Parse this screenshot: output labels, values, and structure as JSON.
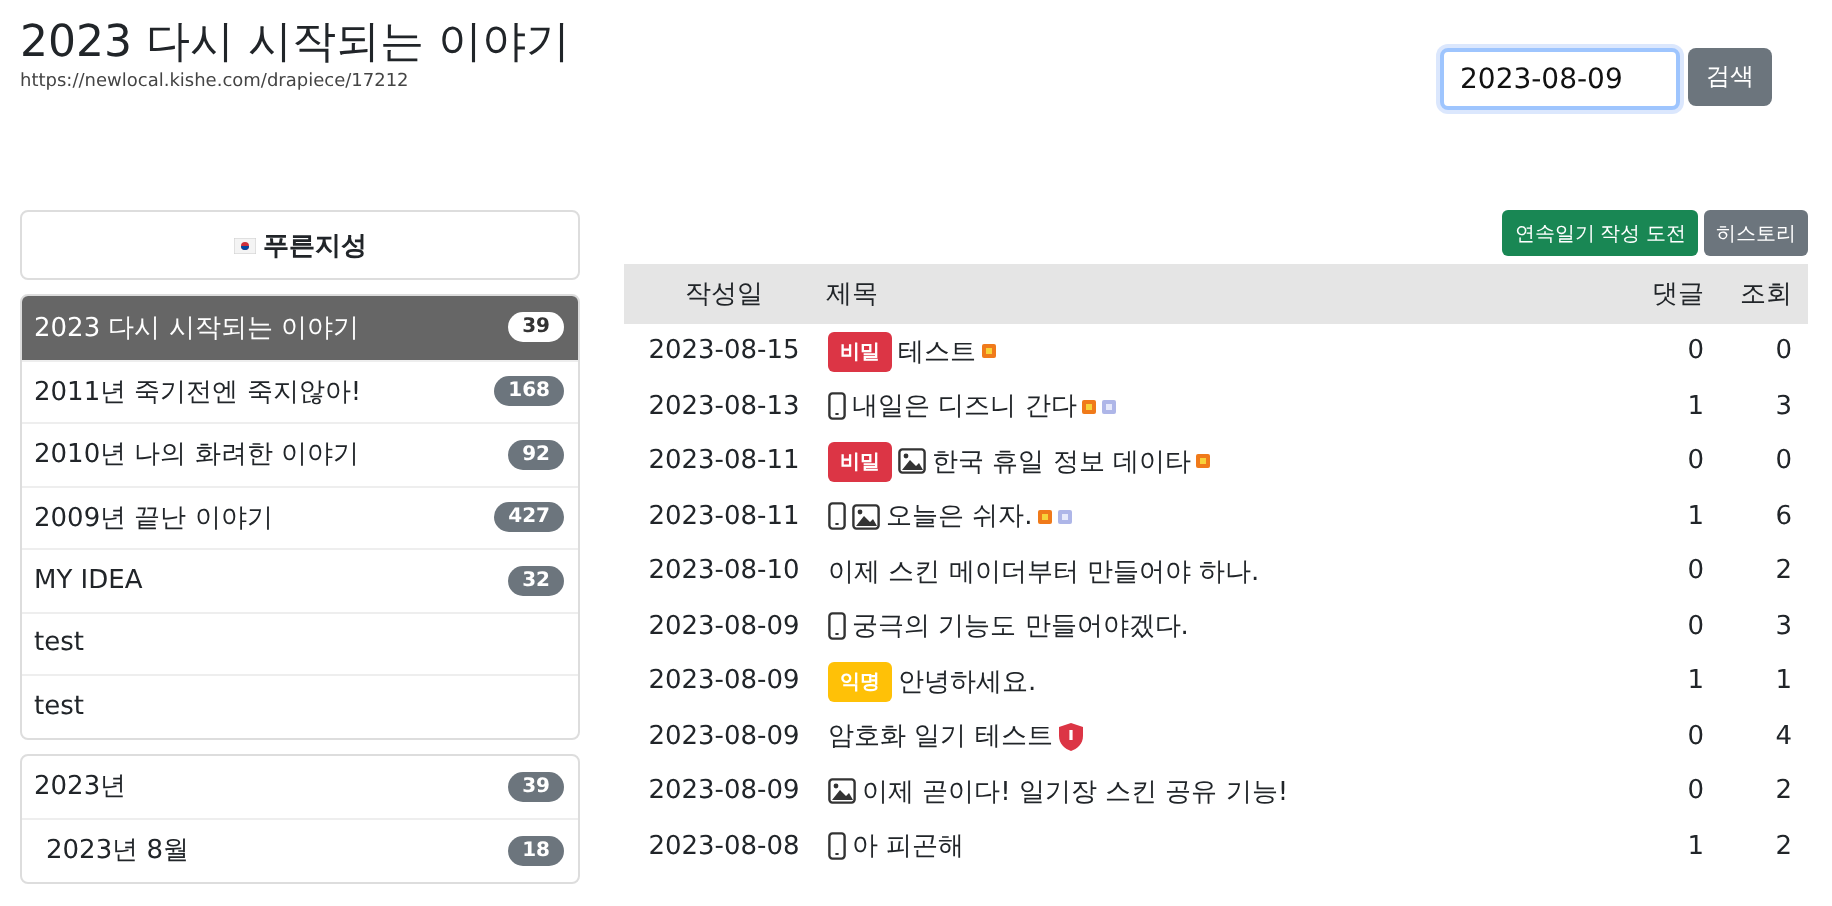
{
  "header": {
    "title": "2023 다시 시작되는 이야기",
    "url": "https://newlocal.kishe.com/drapiece/17212"
  },
  "search": {
    "value": "2023-08-09",
    "button": "검색"
  },
  "profile": {
    "name": "푸른지성"
  },
  "diaries": [
    {
      "name": "2023 다시 시작되는 이야기",
      "count": "39",
      "selected": true
    },
    {
      "name": "2011년 죽기전엔 죽지않아!",
      "count": "168",
      "selected": false
    },
    {
      "name": "2010년 나의 화려한 이야기",
      "count": "92",
      "selected": false
    },
    {
      "name": "2009년 끝난 이야기",
      "count": "427",
      "selected": false
    },
    {
      "name": "MY IDEA",
      "count": "32",
      "selected": false
    },
    {
      "name": "test",
      "selected": false
    },
    {
      "name": "test",
      "selected": false
    }
  ],
  "archive": [
    {
      "name": "2023년",
      "count": "39",
      "children": [
        {
          "name": "2023년 8월",
          "count": "18"
        }
      ]
    }
  ],
  "actions": [
    {
      "label": "연속일기 작성 도전",
      "kind": "primary"
    },
    {
      "label": "히스토리",
      "kind": "secondary"
    }
  ],
  "table": {
    "columns": [
      "작성일",
      "제목",
      "댓글",
      "조회"
    ],
    "rows": [
      {
        "date": "2023-08-15",
        "badge": {
          "text": "비밀",
          "kind": "secret"
        },
        "mobile": false,
        "image": false,
        "title": "테스트",
        "new_mark": true,
        "extra_mark": false,
        "encrypted": false,
        "comments": "0",
        "views": "0"
      },
      {
        "date": "2023-08-13",
        "mobile": true,
        "image": false,
        "title": "내일은 디즈니 간다",
        "new_mark": true,
        "extra_mark": true,
        "encrypted": false,
        "comments": "1",
        "views": "3"
      },
      {
        "date": "2023-08-11",
        "badge": {
          "text": "비밀",
          "kind": "secret"
        },
        "mobile": false,
        "image": true,
        "title": "한국 휴일 정보 데이타",
        "new_mark": true,
        "extra_mark": false,
        "encrypted": false,
        "comments": "0",
        "views": "0"
      },
      {
        "date": "2023-08-11",
        "mobile": true,
        "image": true,
        "title": "오늘은 쉬자.",
        "new_mark": true,
        "extra_mark": true,
        "encrypted": false,
        "comments": "1",
        "views": "6"
      },
      {
        "date": "2023-08-10",
        "mobile": false,
        "image": false,
        "title": "이제 스킨 메이더부터 만들어야 하나.",
        "new_mark": false,
        "extra_mark": false,
        "encrypted": false,
        "comments": "0",
        "views": "2"
      },
      {
        "date": "2023-08-09",
        "mobile": true,
        "image": false,
        "title": "궁극의 기능도 만들어야겠다.",
        "new_mark": false,
        "extra_mark": false,
        "encrypted": false,
        "comments": "0",
        "views": "3"
      },
      {
        "date": "2023-08-09",
        "badge": {
          "text": "익명",
          "kind": "anonymous"
        },
        "mobile": false,
        "image": false,
        "title": "안녕하세요.",
        "new_mark": false,
        "extra_mark": false,
        "encrypted": false,
        "comments": "1",
        "views": "1"
      },
      {
        "date": "2023-08-09",
        "mobile": false,
        "image": false,
        "title": "암호화 일기 테스트",
        "new_mark": false,
        "extra_mark": false,
        "encrypted": true,
        "comments": "0",
        "views": "4"
      },
      {
        "date": "2023-08-09",
        "mobile": false,
        "image": true,
        "title": "이제 곧이다! 일기장 스킨 공유 기능!",
        "new_mark": false,
        "extra_mark": false,
        "encrypted": false,
        "comments": "0",
        "views": "2"
      },
      {
        "date": "2023-08-08",
        "mobile": true,
        "image": false,
        "title": "아 피곤해",
        "new_mark": false,
        "extra_mark": false,
        "encrypted": false,
        "comments": "1",
        "views": "2"
      }
    ]
  }
}
